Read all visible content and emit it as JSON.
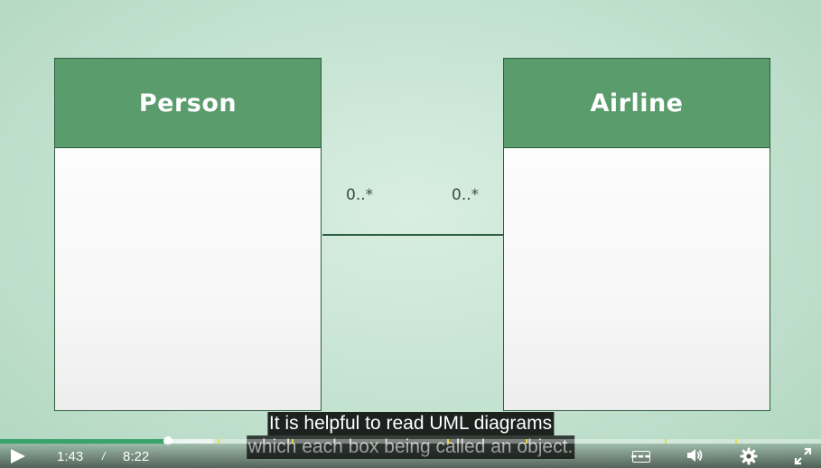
{
  "diagram": {
    "left_class": {
      "name": "Person"
    },
    "right_class": {
      "name": "Airline"
    },
    "left_multiplicity": "0..*",
    "right_multiplicity": "0..*"
  },
  "captions": {
    "line1": "It is helpful to read UML diagrams",
    "line2": "which each box being called an object."
  },
  "player": {
    "current_time": "1:43",
    "separator": "/",
    "duration": "8:22",
    "progress_fraction": 0.205,
    "buffered_fraction": 0.26,
    "chapter_markers": [
      0.265,
      0.355,
      0.545,
      0.64,
      0.81,
      0.895
    ],
    "controls": {
      "play_icon": "play-icon",
      "captions_icon": "closed-captions-icon",
      "volume_icon": "volume-icon",
      "settings_icon": "gear-icon",
      "fullscreen_icon": "fullscreen-icon"
    },
    "colors": {
      "progress": "#38a36a",
      "chapter_marker": "#e6d84a",
      "class_header": "#5a9c6c"
    }
  }
}
